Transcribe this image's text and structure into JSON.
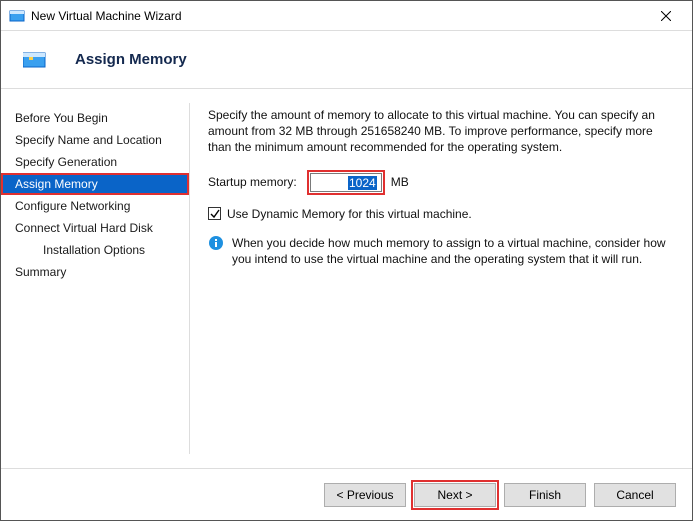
{
  "window": {
    "title": "New Virtual Machine Wizard"
  },
  "header": {
    "title": "Assign Memory"
  },
  "sidebar": {
    "items": [
      {
        "label": "Before You Begin",
        "indent": false,
        "active": false
      },
      {
        "label": "Specify Name and Location",
        "indent": false,
        "active": false
      },
      {
        "label": "Specify Generation",
        "indent": false,
        "active": false
      },
      {
        "label": "Assign Memory",
        "indent": false,
        "active": true,
        "highlight": true
      },
      {
        "label": "Configure Networking",
        "indent": false,
        "active": false
      },
      {
        "label": "Connect Virtual Hard Disk",
        "indent": false,
        "active": false
      },
      {
        "label": "Installation Options",
        "indent": true,
        "active": false
      },
      {
        "label": "Summary",
        "indent": false,
        "active": false
      }
    ]
  },
  "content": {
    "intro": "Specify the amount of memory to allocate to this virtual machine. You can specify an amount from 32 MB through 251658240 MB. To improve performance, specify more than the minimum amount recommended for the operating system.",
    "memory_label": "Startup memory:",
    "memory_value": "1024",
    "memory_unit": "MB",
    "dynamic_checkbox_checked": true,
    "dynamic_checkbox_label": "Use Dynamic Memory for this virtual machine.",
    "info_text": "When you decide how much memory to assign to a virtual machine, consider how you intend to use the virtual machine and the operating system that it will run."
  },
  "footer": {
    "previous": "< Previous",
    "next": "Next >",
    "finish": "Finish",
    "cancel": "Cancel",
    "next_highlight": true
  },
  "colors": {
    "accent": "#0a64c8",
    "highlight": "#e03030"
  }
}
